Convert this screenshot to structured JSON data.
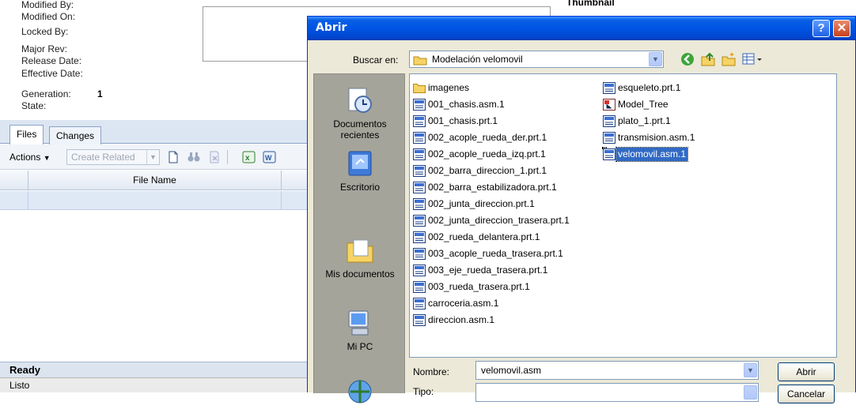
{
  "background": {
    "properties": [
      {
        "label": "Modified By:"
      },
      {
        "label": "Modified On:"
      },
      {
        "label": "Locked By:"
      },
      {
        "label": "Major Rev:"
      },
      {
        "label": "Release Date:"
      },
      {
        "label": "Effective Date:"
      },
      {
        "label": "Generation:",
        "value": "1"
      },
      {
        "label": "State:"
      }
    ],
    "thumbnail_label": "Thumbnail",
    "tabs": [
      "Files",
      "Changes"
    ],
    "toolbar": {
      "actions_label": "Actions",
      "create_related_label": "Create Related"
    },
    "grid": {
      "column_file_name": "File Name"
    },
    "status": {
      "ready": "Ready",
      "listo": "Listo"
    }
  },
  "dialog": {
    "title": "Abrir",
    "help_label": "?",
    "close_label": "✕",
    "look_in_label": "Buscar en:",
    "look_in_value": "Modelación velomovil",
    "places": [
      "Documentos recientes",
      "Escritorio",
      "Mis documentos",
      "Mi PC"
    ],
    "files": [
      {
        "name": "imagenes",
        "icon": "folder-icon"
      },
      {
        "name": "001_chasis.asm.1",
        "icon": "model-file-icon"
      },
      {
        "name": "001_chasis.prt.1",
        "icon": "model-file-icon"
      },
      {
        "name": "002_acople_rueda_der.prt.1",
        "icon": "model-file-icon"
      },
      {
        "name": "002_acople_rueda_izq.prt.1",
        "icon": "model-file-icon"
      },
      {
        "name": "002_barra_direccion_1.prt.1",
        "icon": "model-file-icon"
      },
      {
        "name": "002_barra_estabilizadora.prt.1",
        "icon": "model-file-icon"
      },
      {
        "name": "002_junta_direccion.prt.1",
        "icon": "model-file-icon"
      },
      {
        "name": "002_junta_direccion_trasera.prt.1",
        "icon": "model-file-icon"
      },
      {
        "name": "002_rueda_delantera.prt.1",
        "icon": "model-file-icon"
      },
      {
        "name": "003_acople_rueda_trasera.prt.1",
        "icon": "model-file-icon"
      },
      {
        "name": "003_eje_rueda_trasera.prt.1",
        "icon": "model-file-icon"
      },
      {
        "name": "003_rueda_trasera.prt.1",
        "icon": "model-file-icon"
      },
      {
        "name": "carroceria.asm.1",
        "icon": "model-file-icon"
      },
      {
        "name": "direccion.asm.1",
        "icon": "model-file-icon"
      },
      {
        "name": "esqueleto.prt.1",
        "icon": "model-file-icon"
      },
      {
        "name": "Model_Tree",
        "icon": "model-tree-icon"
      },
      {
        "name": "plato_1.prt.1",
        "icon": "model-file-icon"
      },
      {
        "name": "transmision.asm.1",
        "icon": "model-file-icon"
      },
      {
        "name": "velomovil.asm.1",
        "icon": "model-file-icon",
        "selected": true
      }
    ],
    "file_name_label": "Nombre:",
    "file_name_value": "velomovil.asm",
    "file_type_label": "Tipo:",
    "open_label": "Abrir",
    "cancel_label": "Cancelar"
  }
}
